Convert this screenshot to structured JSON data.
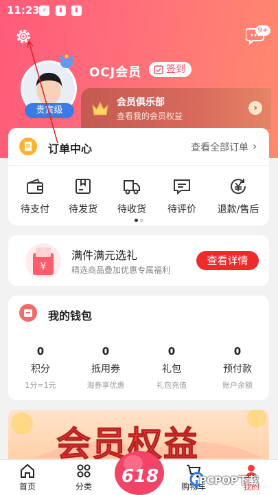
{
  "status": {
    "time": "11:23"
  },
  "header": {
    "message_badge": "9+"
  },
  "profile": {
    "username": "OCJ会员",
    "checkin_label": "签到",
    "level": "贵宾级"
  },
  "club": {
    "title": "会员俱乐部",
    "subtitle": "查看我的会员权益",
    "arrow": "›"
  },
  "orders": {
    "title": "订单中心",
    "view_all": "查看全部订单",
    "view_all_arrow": "›",
    "items": [
      {
        "label": "待支付",
        "icon": "wallet-icon"
      },
      {
        "label": "待发货",
        "icon": "box-icon"
      },
      {
        "label": "待收货",
        "icon": "truck-icon"
      },
      {
        "label": "待评价",
        "icon": "comment-icon"
      },
      {
        "label": "退款/售后",
        "icon": "refund-icon"
      }
    ]
  },
  "promo": {
    "title": "满件满元选礼",
    "subtitle": "精选商品叠加优惠专属福利",
    "button": "查看详情",
    "gift_symbol": "¥"
  },
  "wallet": {
    "title": "我的钱包",
    "items": [
      {
        "value": "0",
        "name": "积分",
        "hint": "1分=1元"
      },
      {
        "value": "0",
        "name": "抵用券",
        "hint": "淘券享优惠"
      },
      {
        "value": "0",
        "name": "礼包",
        "hint": "礼包充值"
      },
      {
        "value": "0",
        "name": "预付款",
        "hint": "账户余额"
      }
    ]
  },
  "banner": {
    "text": "会员权益"
  },
  "tabbar": {
    "items": [
      {
        "label": "首页",
        "icon": "home-icon"
      },
      {
        "label": "分类",
        "icon": "category-icon"
      },
      {
        "label": "购物车",
        "icon": "cart-icon"
      },
      {
        "label": "我的",
        "icon": "profile-icon"
      }
    ],
    "center_label": "618"
  },
  "watermark": "PCPOP下载",
  "colors": {
    "accent": "#ff5a79",
    "button_red": "#ef2a2a",
    "orders_icon": "#ffb230",
    "wallet_icon": "#f26b6b",
    "level_badge": "#3b7be8",
    "club_banner": "#c45a52"
  }
}
